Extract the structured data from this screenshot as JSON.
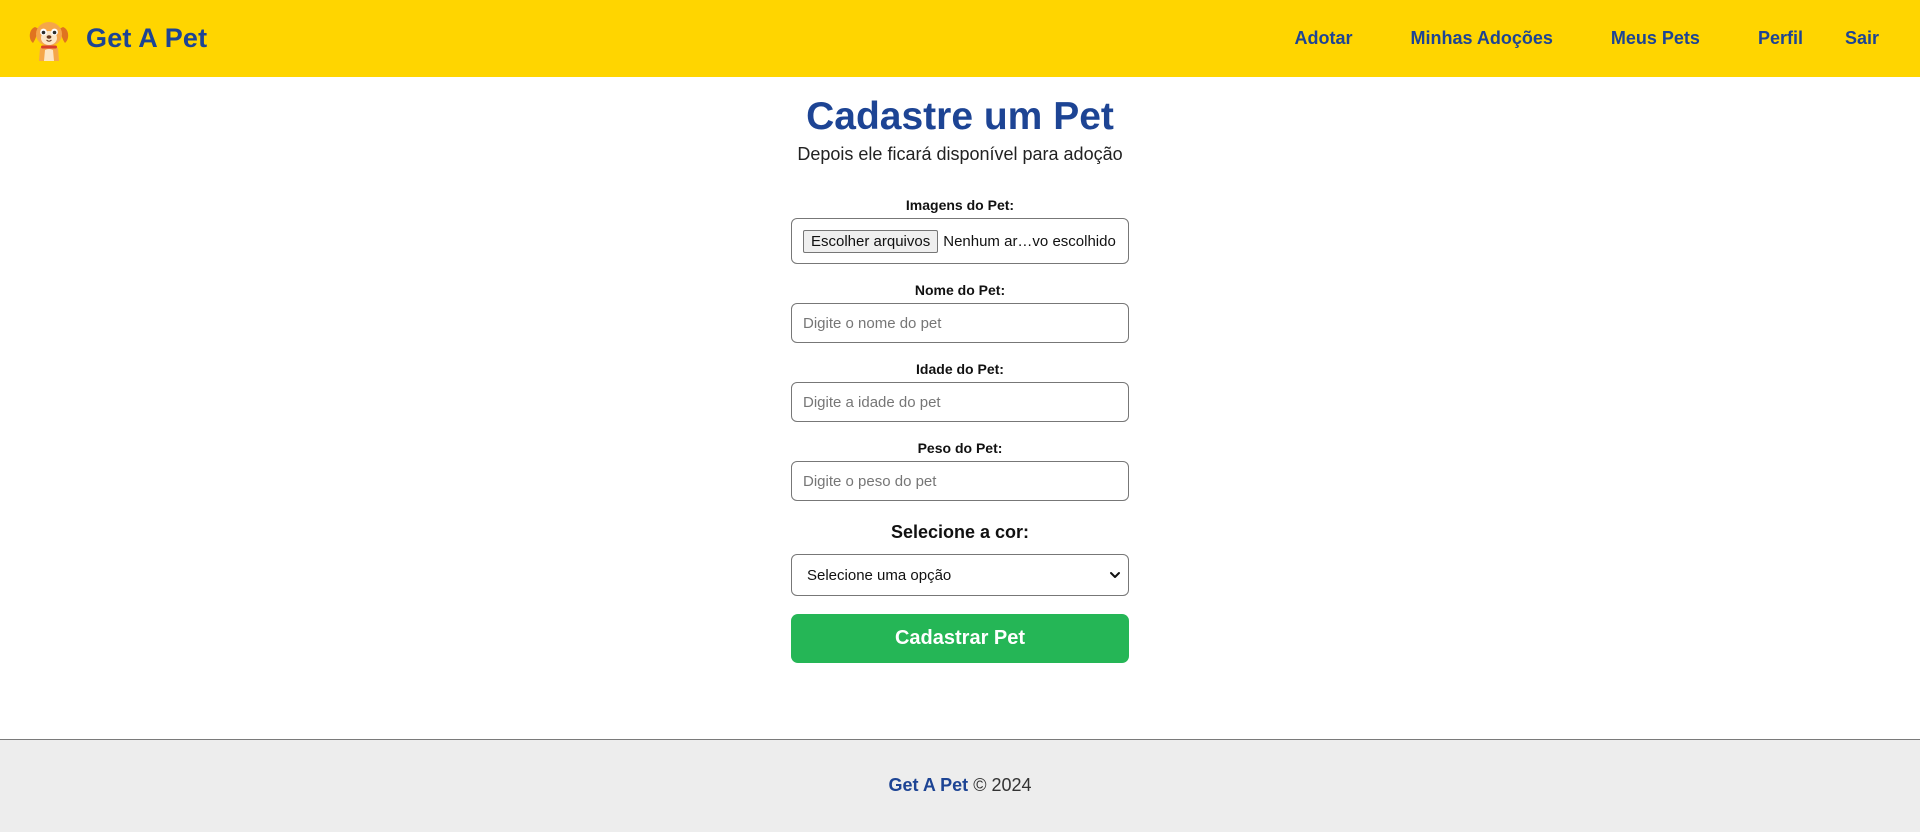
{
  "navbar": {
    "brand_name": "Get A Pet",
    "logo_icon": "dog-logo-icon",
    "links": [
      {
        "label": "Adotar"
      },
      {
        "label": "Minhas Adoções"
      },
      {
        "label": "Meus Pets"
      },
      {
        "label": "Perfil"
      },
      {
        "label": "Sair"
      }
    ]
  },
  "main": {
    "title": "Cadastre um Pet",
    "subtitle": "Depois ele ficará disponível para adoção"
  },
  "form": {
    "images": {
      "label": "Imagens do Pet:",
      "button_label": "Escolher arquivos",
      "status": "Nenhum ar…vo escolhido"
    },
    "name": {
      "label": "Nome do Pet:",
      "value": "",
      "placeholder": "Digite o nome do pet"
    },
    "age": {
      "label": "Idade do Pet:",
      "value": "",
      "placeholder": "Digite a idade do pet"
    },
    "weight": {
      "label": "Peso do Pet:",
      "value": "",
      "placeholder": "Digite o peso do pet"
    },
    "color": {
      "label": "Selecione a cor:",
      "selected": "Selecione uma opção",
      "icon": "chevron-down-icon"
    },
    "submit_label": "Cadastrar Pet"
  },
  "footer": {
    "brand": "Get A Pet",
    "copyright": "© 2024"
  },
  "colors": {
    "navbar_bg": "#ffd500",
    "brand_blue": "#1d4494",
    "submit_green": "#25b656",
    "footer_bg": "#ededed"
  }
}
